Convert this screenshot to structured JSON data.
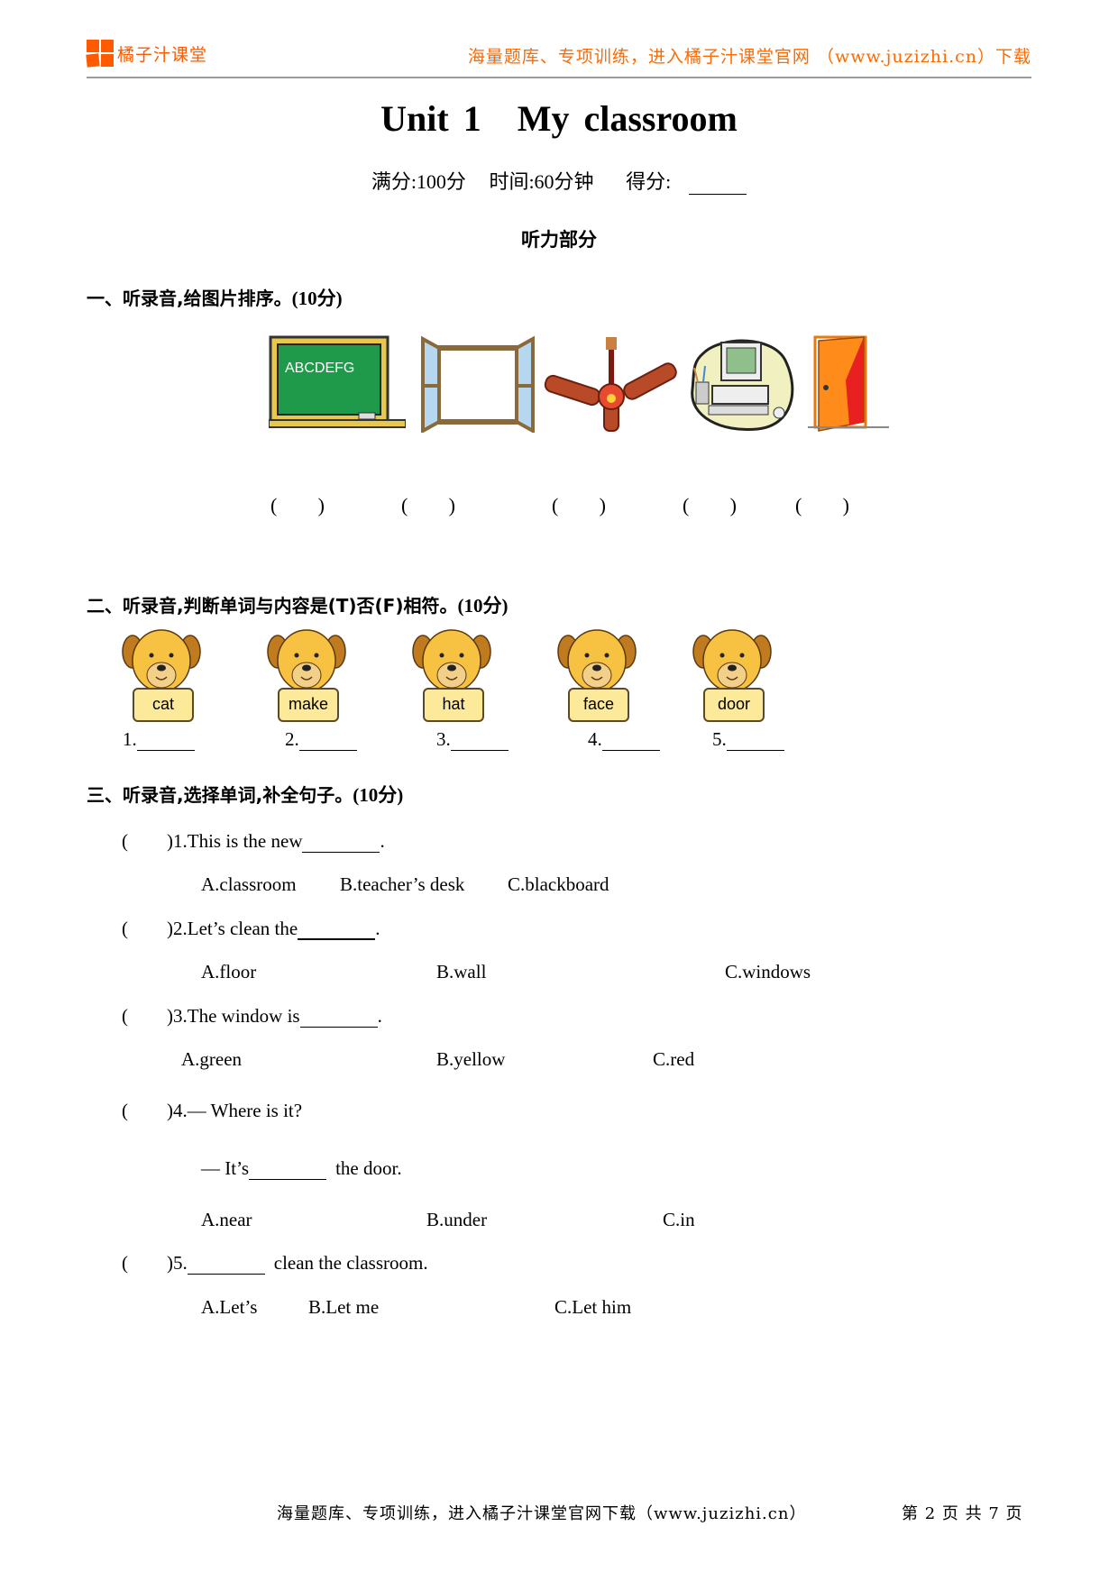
{
  "header": {
    "logo_text": "橘子汁课堂",
    "slogan": "海量题库、专项训练，进入橘子汁课堂官网 （www.juzizhi.cn）下载",
    "brand_color": "#ff5a00"
  },
  "title": {
    "unit": "Unit 1",
    "name": "My classroom"
  },
  "meta": {
    "full_score": "满分:100分",
    "time": "时间:60分钟",
    "score_label": "得分:"
  },
  "part_title": "听力部分",
  "section1": {
    "title": "一、听录音,给图片排序。",
    "points": "(10分)",
    "pictures": [
      {
        "icon": "blackboard-icon",
        "text": "ABCDEFG"
      },
      {
        "icon": "window-icon"
      },
      {
        "icon": "ceiling-fan-icon"
      },
      {
        "icon": "computer-icon"
      },
      {
        "icon": "door-icon"
      }
    ],
    "answers": [
      "(",
      "(",
      "(",
      "(",
      "("
    ],
    "close": ")"
  },
  "section2": {
    "title": "二、听录音,判断单词与内容是(T)否(F)相符。",
    "points": "(10分)",
    "bears": [
      "cat",
      "make",
      "hat",
      "face",
      "door"
    ],
    "answer_labels": [
      "1.",
      "2.",
      "3.",
      "4.",
      "5."
    ]
  },
  "section3": {
    "title": "三、听录音,选择单词,补全句子。",
    "points": "(10分)",
    "questions": [
      {
        "paren": "(",
        "num": ")1.",
        "text_before": "This is the new",
        "text_after": ".",
        "options": [
          "A.classroom",
          "B.teacher’s desk",
          "C.blackboard"
        ]
      },
      {
        "paren": "(",
        "num": ")2.",
        "text_before": "Let’s clean the",
        "text_after": ".",
        "options": [
          "A.floor",
          "B.wall",
          "C.windows"
        ]
      },
      {
        "paren": "(",
        "num": ")3.",
        "text_before": "The window is",
        "text_after": ".",
        "options": [
          "A.green",
          "B.yellow",
          "C.red"
        ]
      },
      {
        "paren": "(",
        "num": ")4.",
        "text_before": "— Where is it?",
        "line2_before": "— It’s",
        "line2_after": "the door.",
        "options": [
          "A.near",
          "B.under",
          "C.in"
        ]
      },
      {
        "paren": "(",
        "num": ")5.",
        "text_before": "",
        "text_after": "clean the classroom.",
        "options": [
          "A.Let’s",
          "B.Let me",
          "C.Let him"
        ]
      }
    ]
  },
  "footer": {
    "slogan": "海量题库、专项训练，进入橘子汁课堂官网下载（www.juzizhi.cn）",
    "page": "第 2 页 共 7 页"
  }
}
